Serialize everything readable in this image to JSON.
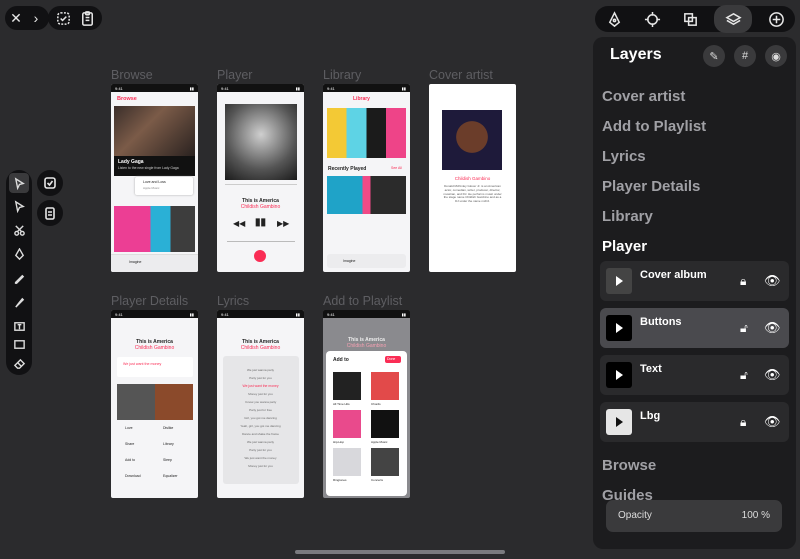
{
  "toolbar_left": {
    "close": "✕",
    "chevron": "›"
  },
  "artboards": {
    "browse": {
      "label": "Browse",
      "header": "Browse",
      "hero_title": "Lady Gaga",
      "hero_sub": "Listen to the new single from Lady Gaga",
      "card_title": "Love and Loss",
      "card_sub": "Apple Music",
      "mini_title": "Imagine"
    },
    "player": {
      "label": "Player",
      "song": "This is America",
      "artist": "Childish Gambino"
    },
    "library": {
      "label": "Library",
      "header": "Library",
      "section": "Recently Played",
      "see_all": "See All",
      "mini_title": "Imagine"
    },
    "cover": {
      "label": "Cover artist",
      "artist": "Childish Gambino",
      "bio": "Donald McKinley Glover Jr. is an American actor, comedian, writer, producer, director, musician, and DJ. He performs music under the stage name Childish Gambino and as a DJ under the name mcDJ."
    },
    "details": {
      "label": "Player Details",
      "song": "This is America",
      "artist": "Childish Gambino",
      "lyric": "We just want the money",
      "actions": [
        "Love",
        "Dislike",
        "Share",
        "Library",
        "Add to",
        "Sleep",
        "Download",
        "Equalizer"
      ]
    },
    "lyrics": {
      "label": "Lyrics",
      "song": "This is America",
      "artist": "Childish Gambino",
      "lines": [
        "We just wanna party",
        "Party just for you",
        "We just want the money",
        "Money just for you",
        "I know you wanna party",
        "Party just for free",
        "Girl, you got me dancing",
        "Yeah, girl, you got me dancing",
        "Dance and shake the frame",
        "We just wanna party",
        "Party just for you",
        "We just want the money",
        "Money just for you"
      ]
    },
    "playlist": {
      "label": "Add to Playlist",
      "song": "This is America",
      "artist": "Childish Gambino",
      "title": "Add to",
      "done": "Done",
      "items": [
        "All Time Hits",
        "Chords",
        "Hip-Hop",
        "Apple Music",
        "Ringtones",
        "Concerts"
      ]
    }
  },
  "layers": {
    "title": "Layers",
    "items_top": [
      "Cover artist",
      "Add to Playlist",
      "Lyrics",
      "Player Details",
      "Library"
    ],
    "current": "Player",
    "children": [
      "Cover album",
      "Buttons",
      "Text",
      "Lbg"
    ],
    "items_bottom": [
      "Browse",
      "Guides"
    ],
    "opacity_label": "Opacity",
    "opacity_value": "100 %"
  },
  "status_time": "9:41"
}
